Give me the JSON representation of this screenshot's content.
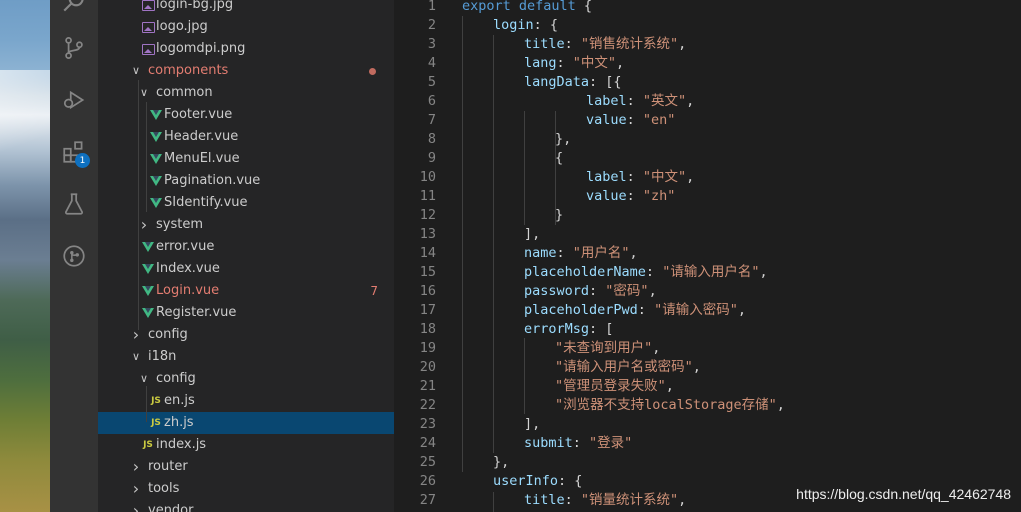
{
  "activity_bar": {
    "icons": [
      "search-icon",
      "source-control-icon",
      "debug-icon",
      "extensions-icon",
      "test-flask-icon",
      "git-graph-icon"
    ],
    "extensions_badge": "1"
  },
  "explorer": {
    "items": [
      {
        "label": "login-bg.jpg",
        "type": "image"
      },
      {
        "label": "logo.jpg",
        "type": "image"
      },
      {
        "label": "logomdpi.png",
        "type": "image"
      },
      {
        "label": "components",
        "type": "folder-open",
        "modified": true
      },
      {
        "label": "common",
        "type": "folder-open"
      },
      {
        "label": "Footer.vue",
        "type": "vue"
      },
      {
        "label": "Header.vue",
        "type": "vue"
      },
      {
        "label": "MenuEl.vue",
        "type": "vue"
      },
      {
        "label": "Pagination.vue",
        "type": "vue"
      },
      {
        "label": "SIdentify.vue",
        "type": "vue"
      },
      {
        "label": "system",
        "type": "folder-closed"
      },
      {
        "label": "error.vue",
        "type": "vue"
      },
      {
        "label": "Index.vue",
        "type": "vue"
      },
      {
        "label": "Login.vue",
        "type": "vue",
        "modified": true,
        "problems": "7"
      },
      {
        "label": "Register.vue",
        "type": "vue"
      },
      {
        "label": "config",
        "type": "folder-closed"
      },
      {
        "label": "i18n",
        "type": "folder-open"
      },
      {
        "label": "config",
        "type": "folder-open"
      },
      {
        "label": "en.js",
        "type": "js"
      },
      {
        "label": "zh.js",
        "type": "js",
        "selected": true
      },
      {
        "label": "index.js",
        "type": "js"
      },
      {
        "label": "router",
        "type": "folder-closed"
      },
      {
        "label": "tools",
        "type": "folder-closed"
      },
      {
        "label": "vendor",
        "type": "folder-closed"
      }
    ]
  },
  "editor": {
    "lines": [
      {
        "n": "1",
        "code": [
          [
            "kw",
            "export default"
          ],
          [
            "pun",
            " {"
          ]
        ]
      },
      {
        "n": "2",
        "code": [
          [
            "key",
            "login"
          ],
          [
            "pun",
            ": {"
          ]
        ]
      },
      {
        "n": "3",
        "code": [
          [
            "key",
            "title"
          ],
          [
            "pun",
            ": "
          ],
          [
            "str",
            "\"销售统计系统\""
          ],
          [
            "pun",
            ","
          ]
        ]
      },
      {
        "n": "4",
        "code": [
          [
            "key",
            "lang"
          ],
          [
            "pun",
            ": "
          ],
          [
            "str",
            "\"中文\""
          ],
          [
            "pun",
            ","
          ]
        ]
      },
      {
        "n": "5",
        "code": [
          [
            "key",
            "langData"
          ],
          [
            "pun",
            ": [{"
          ]
        ]
      },
      {
        "n": "6",
        "code": [
          [
            "key",
            "label"
          ],
          [
            "pun",
            ": "
          ],
          [
            "str",
            "\"英文\""
          ],
          [
            "pun",
            ","
          ]
        ]
      },
      {
        "n": "7",
        "code": [
          [
            "key",
            "value"
          ],
          [
            "pun",
            ": "
          ],
          [
            "str",
            "\"en\""
          ]
        ]
      },
      {
        "n": "8",
        "code": [
          [
            "pun",
            "},"
          ]
        ]
      },
      {
        "n": "9",
        "code": [
          [
            "pun",
            "{"
          ]
        ]
      },
      {
        "n": "10",
        "code": [
          [
            "key",
            "label"
          ],
          [
            "pun",
            ": "
          ],
          [
            "str",
            "\"中文\""
          ],
          [
            "pun",
            ","
          ]
        ]
      },
      {
        "n": "11",
        "code": [
          [
            "key",
            "value"
          ],
          [
            "pun",
            ": "
          ],
          [
            "str",
            "\"zh\""
          ]
        ]
      },
      {
        "n": "12",
        "code": [
          [
            "pun",
            "}"
          ]
        ]
      },
      {
        "n": "13",
        "code": [
          [
            "pun",
            "],"
          ]
        ]
      },
      {
        "n": "14",
        "code": [
          [
            "key",
            "name"
          ],
          [
            "pun",
            ": "
          ],
          [
            "str",
            "\"用户名\""
          ],
          [
            "pun",
            ","
          ]
        ]
      },
      {
        "n": "15",
        "code": [
          [
            "key",
            "placeholderName"
          ],
          [
            "pun",
            ": "
          ],
          [
            "str",
            "\"请输入用户名\""
          ],
          [
            "pun",
            ","
          ]
        ]
      },
      {
        "n": "16",
        "code": [
          [
            "key",
            "password"
          ],
          [
            "pun",
            ": "
          ],
          [
            "str",
            "\"密码\""
          ],
          [
            "pun",
            ","
          ]
        ]
      },
      {
        "n": "17",
        "code": [
          [
            "key",
            "placeholderPwd"
          ],
          [
            "pun",
            ": "
          ],
          [
            "str",
            "\"请输入密码\""
          ],
          [
            "pun",
            ","
          ]
        ]
      },
      {
        "n": "18",
        "code": [
          [
            "key",
            "errorMsg"
          ],
          [
            "pun",
            ": ["
          ]
        ]
      },
      {
        "n": "19",
        "code": [
          [
            "str",
            "\"未查询到用户\""
          ],
          [
            "pun",
            ","
          ]
        ]
      },
      {
        "n": "20",
        "code": [
          [
            "str",
            "\"请输入用户名或密码\""
          ],
          [
            "pun",
            ","
          ]
        ]
      },
      {
        "n": "21",
        "code": [
          [
            "str",
            "\"管理员登录失败\""
          ],
          [
            "pun",
            ","
          ]
        ]
      },
      {
        "n": "22",
        "code": [
          [
            "str",
            "\"浏览器不支持localStorage存储\""
          ],
          [
            "pun",
            ","
          ]
        ]
      },
      {
        "n": "23",
        "code": [
          [
            "pun",
            "],"
          ]
        ]
      },
      {
        "n": "24",
        "code": [
          [
            "key",
            "submit"
          ],
          [
            "pun",
            ": "
          ],
          [
            "str",
            "\"登录\""
          ]
        ]
      },
      {
        "n": "25",
        "code": [
          [
            "pun",
            "},"
          ]
        ]
      },
      {
        "n": "26",
        "code": [
          [
            "key",
            "userInfo"
          ],
          [
            "pun",
            ": {"
          ]
        ]
      },
      {
        "n": "27",
        "code": [
          [
            "key",
            "title"
          ],
          [
            "pun",
            ": "
          ],
          [
            "str",
            "\"销量统计系统\""
          ],
          [
            "pun",
            ","
          ]
        ]
      }
    ]
  },
  "watermark": "https://blog.csdn.net/qq_42462748",
  "colors": {
    "activity_bar": "#333333",
    "sidebar": "#252526",
    "editor": "#1e1e1e",
    "selection": "#094771",
    "keyword": "#569cd6",
    "property": "#9cdcfe",
    "string": "#ce9178",
    "modified": "#e37d71",
    "vue_green": "#41b883",
    "js_yellow": "#cbcb41"
  }
}
